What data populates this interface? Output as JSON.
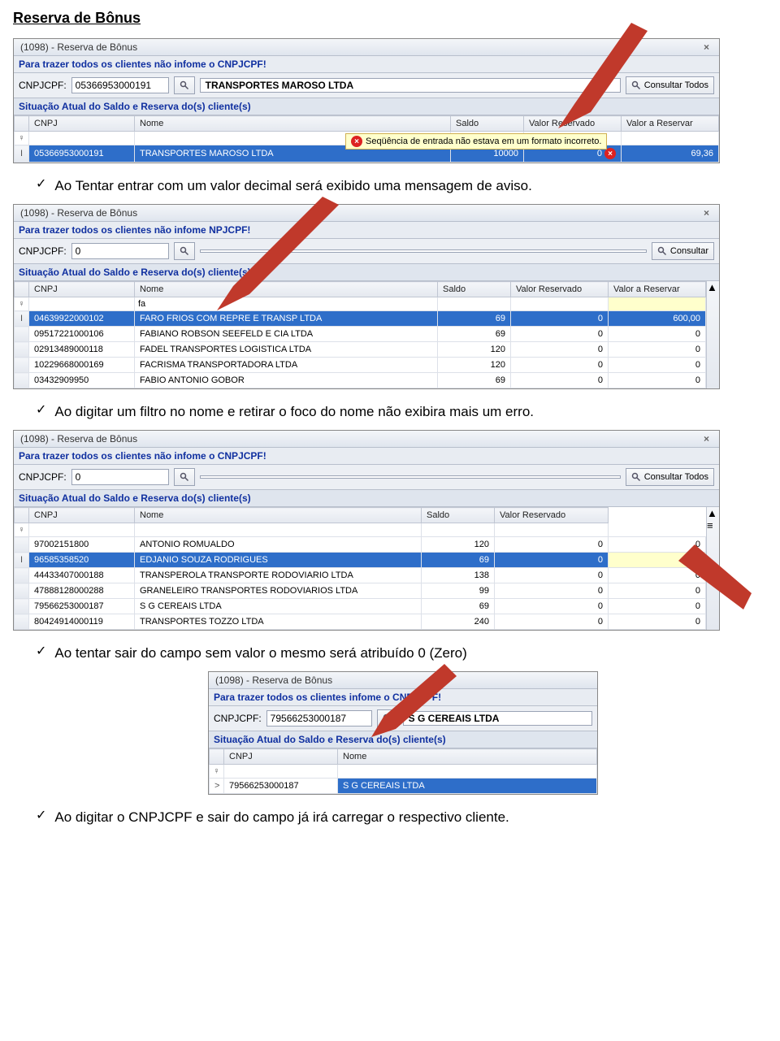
{
  "page_title": "Reserva de Bônus",
  "bullets": {
    "b1": "Ao Tentar entrar com um  valor decimal será exibido uma mensagem de aviso.",
    "b2": "Ao digitar um filtro no nome e retirar o foco do nome não exibira mais um erro.",
    "b3": "Ao tentar sair do campo sem valor o mesmo será atribuído 0 (Zero)",
    "b4": "Ao digitar o CNPJCPF e sair do campo já irá carregar o respectivo cliente."
  },
  "common": {
    "window_title": "(1098) - Reserva de Bônus",
    "instruction": "Para trazer todos os clientes não infome o CNPJCPF!",
    "cnpj_label": "CNPJCPF:",
    "section_header": "Situação Atual do Saldo e Reserva do(s) cliente(s)",
    "consultar_todos": "Consultar Todos",
    "consultar": "Consultar",
    "cols": {
      "cnpj": "CNPJ",
      "nome": "Nome",
      "saldo": "Saldo",
      "vreservado": "Valor Reservado",
      "vreservar": "Valor a Reservar"
    }
  },
  "win1": {
    "cnpj_value": "05366953000191",
    "client_name": "TRANSPORTES MAROSO LTDA",
    "error_msg": "Seqüência de entrada não estava em um formato incorreto.",
    "row": {
      "cnpj": "05366953000191",
      "nome": "TRANSPORTES MAROSO LTDA",
      "saldo": "10000",
      "vreservado": "0",
      "vreservar": "69,36"
    }
  },
  "win2": {
    "cnpj_value": "0",
    "instruction_partial": "Para trazer todos os clientes não infome   NPJCPF!",
    "filter_nome": "fa",
    "rows": [
      {
        "cnpj": "04639922000102",
        "nome": "FARO FRIOS COM REPRE E TRANSP LTDA",
        "saldo": "69",
        "vres": "0",
        "vr": "600,00",
        "sel": true
      },
      {
        "cnpj": "09517221000106",
        "nome": "FABIANO ROBSON SEEFELD E CIA LTDA",
        "saldo": "69",
        "vres": "0",
        "vr": "0"
      },
      {
        "cnpj": "02913489000118",
        "nome": "FADEL TRANSPORTES LOGISTICA LTDA",
        "saldo": "120",
        "vres": "0",
        "vr": "0"
      },
      {
        "cnpj": "10229668000169",
        "nome": "FACRISMA TRANSPORTADORA LTDA",
        "saldo": "120",
        "vres": "0",
        "vr": "0"
      },
      {
        "cnpj": "03432909950",
        "nome": "FABIO ANTONIO GOBOR",
        "saldo": "69",
        "vres": "0",
        "vr": "0"
      }
    ]
  },
  "win3": {
    "cnpj_value": "0",
    "rows": [
      {
        "cnpj": "97002151800",
        "nome": "ANTONIO ROMUALDO",
        "saldo": "120",
        "vres": "0",
        "vr": "0"
      },
      {
        "cnpj": "96585358520",
        "nome": "EDJANIO SOUZA RODRIGUES",
        "saldo": "69",
        "vres": "0",
        "vr": "",
        "sel": true,
        "editing": true
      },
      {
        "cnpj": "44433407000188",
        "nome": "TRANSPEROLA TRANSPORTE RODOVIARIO LTDA",
        "saldo": "138",
        "vres": "0",
        "vr": "0"
      },
      {
        "cnpj": "47888128000288",
        "nome": "GRANELEIRO TRANSPORTES RODOVIARIOS LTDA",
        "saldo": "99",
        "vres": "0",
        "vr": "0"
      },
      {
        "cnpj": "79566253000187",
        "nome": "S G CEREAIS LTDA",
        "saldo": "69",
        "vres": "0",
        "vr": "0"
      },
      {
        "cnpj": "80424914000119",
        "nome": "TRANSPORTES TOZZO LTDA",
        "saldo": "240",
        "vres": "0",
        "vr": "0"
      }
    ]
  },
  "win4": {
    "cnpj_value": "79566253000187",
    "client_name": "S G CEREAIS LTDA",
    "row": {
      "cnpj": "79566253000187",
      "nome": "S G CEREAIS LTDA"
    },
    "instruction_partial": "Para trazer todos os clientes       infome o CNPJCPF!"
  }
}
